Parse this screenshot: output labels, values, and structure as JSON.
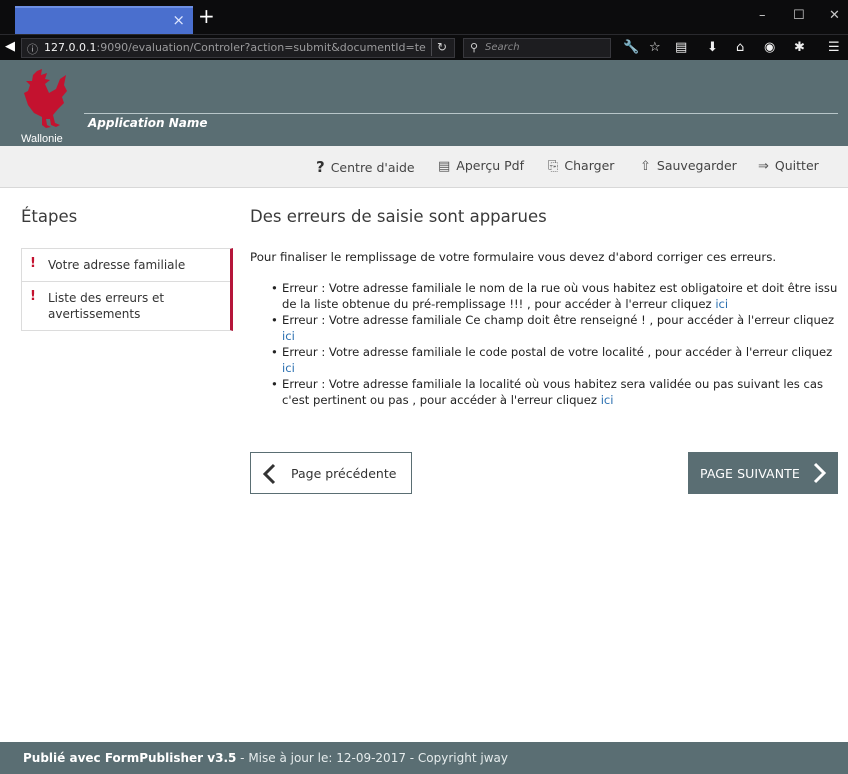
{
  "browser": {
    "tab_title": "",
    "tab_close": "×",
    "new_tab": "+",
    "window_controls": [
      "–",
      "☐",
      "✕"
    ],
    "url_host": "127.0.0.1",
    "url_rest": ":9090/evaluation/Controler?action=submit&documentId=te",
    "search_placeholder": "Search",
    "toolbar_icons": [
      "wrench-icon",
      "star-icon",
      "reader-icon",
      "download-icon",
      "home-icon",
      "pocket-icon",
      "extension-icon",
      "menu-icon"
    ]
  },
  "header": {
    "brand": "Wallonie",
    "app_name": "Application Name",
    "brand_color": "#c4122f",
    "bar_color": "#5a6e73"
  },
  "toolbar": {
    "help": "Centre d'aide",
    "preview_pdf": "Aperçu Pdf",
    "load": "Charger",
    "save": "Sauvegarder",
    "quit": "Quitter"
  },
  "sidebar": {
    "title": "Étapes",
    "items": [
      {
        "label": "Votre adresse familiale",
        "status": "!"
      },
      {
        "label": "Liste des erreurs et avertissements",
        "status": "!"
      }
    ]
  },
  "main": {
    "title": "Des erreurs de saisie sont apparues",
    "intro": "Pour finaliser le remplissage de votre formulaire vous devez d'abord corriger ces erreurs.",
    "link_label": "ici",
    "errors": [
      "Erreur : Votre adresse familiale le nom de la rue où vous habitez est obligatoire et doit être issu de la liste obtenue du pré-remplissage !!! , pour accéder à l'erreur cliquez ",
      "Erreur : Votre adresse familiale Ce champ doit être renseigné ! , pour accéder à l'erreur cliquez ",
      "Erreur : Votre adresse familiale le code postal de votre localité , pour accéder à l'erreur cliquez ",
      "Erreur : Votre adresse familiale la localité où vous habitez sera validée ou pas suivant les cas c'est pertinent ou pas , pour accéder à l'erreur cliquez "
    ],
    "prev_button": "Page précédente",
    "next_button": "PAGE SUIVANTE"
  },
  "footer": {
    "published": "Publié avec FormPublisher v3.5",
    "rest": " - Mise à jour le: 12-09-2017 - Copyright jway"
  }
}
